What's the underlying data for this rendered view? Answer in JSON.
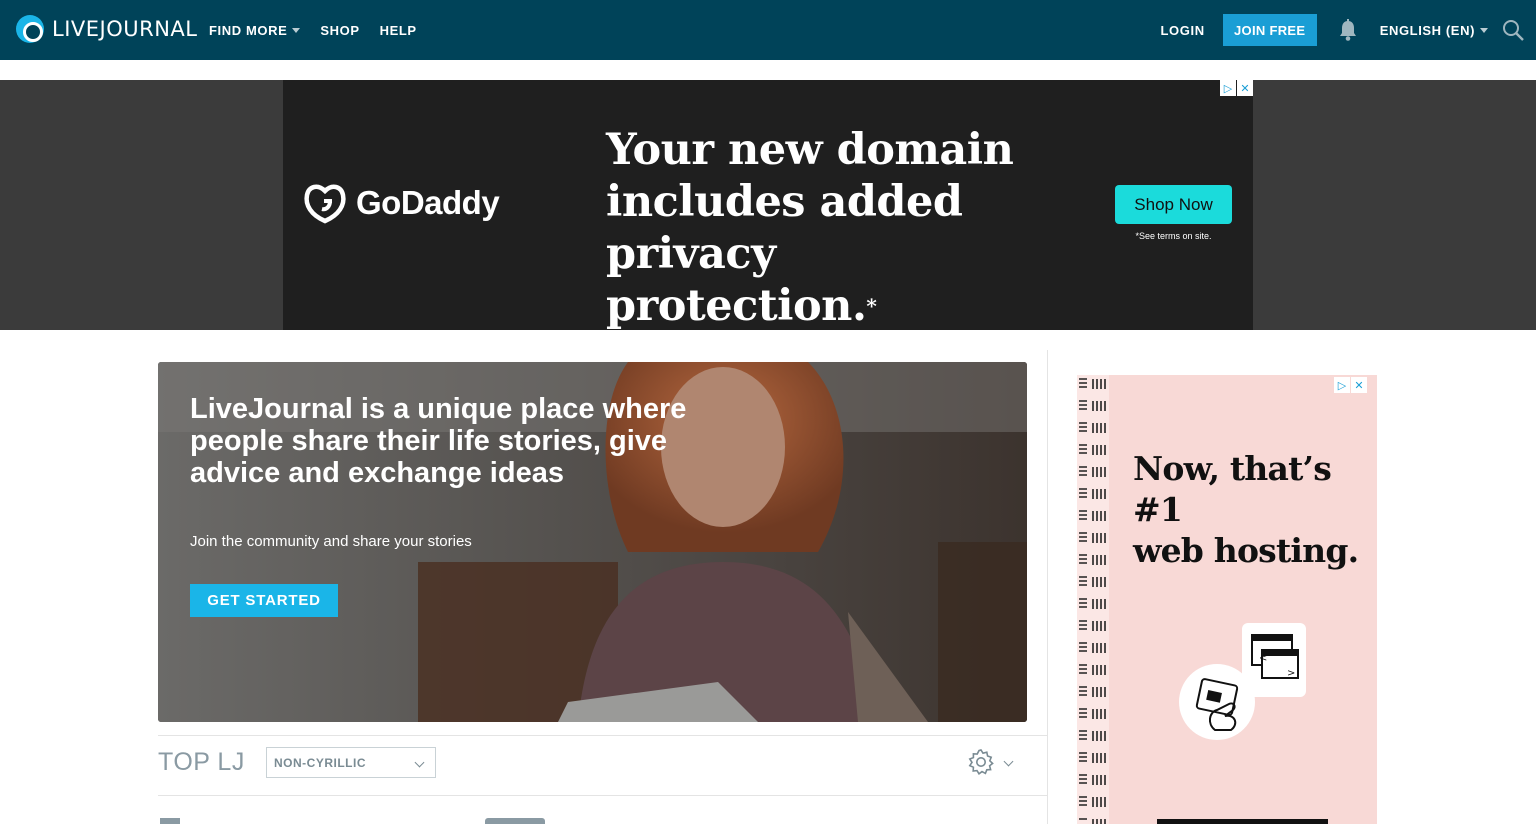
{
  "header": {
    "logo_text": "LIVEJOURNAL",
    "nav": [
      {
        "label": "FIND MORE",
        "has_dropdown": true
      },
      {
        "label": "SHOP",
        "has_dropdown": false
      },
      {
        "label": "HELP",
        "has_dropdown": false
      }
    ],
    "login_label": "LOGIN",
    "join_label": "JOIN FREE",
    "language_label": "ENGLISH (EN)",
    "icons": [
      "livejournal-logo-icon",
      "bell-icon",
      "search-icon"
    ]
  },
  "top_ad": {
    "brand": "GoDaddy",
    "headline_lines": [
      "Your new domain",
      "includes added",
      "privacy protection."
    ],
    "headline_mark": "*",
    "cta": "Shop Now",
    "footnote": "*See terms on site.",
    "colors": {
      "background": "#1f1f1f",
      "cta": "#1bdbdb"
    }
  },
  "hero": {
    "title": "LiveJournal is a unique place where people share their life stories, give advice and exchange ideas",
    "subtitle": "Join the community and share your stories",
    "cta": "GET STARTED"
  },
  "top_lj": {
    "title": "TOP LJ",
    "filter_value": "NON-CYRILLIC",
    "icons": [
      "gear-icon",
      "chevron-down-icon"
    ]
  },
  "side_ad": {
    "headline_lines": [
      "Now, that’s #1",
      "web hosting."
    ],
    "colors": {
      "background": "#f8d9d6"
    }
  },
  "colors": {
    "header_bg": "#004359",
    "accent": "#1ab5e8",
    "join_button": "#1a9ed5"
  }
}
